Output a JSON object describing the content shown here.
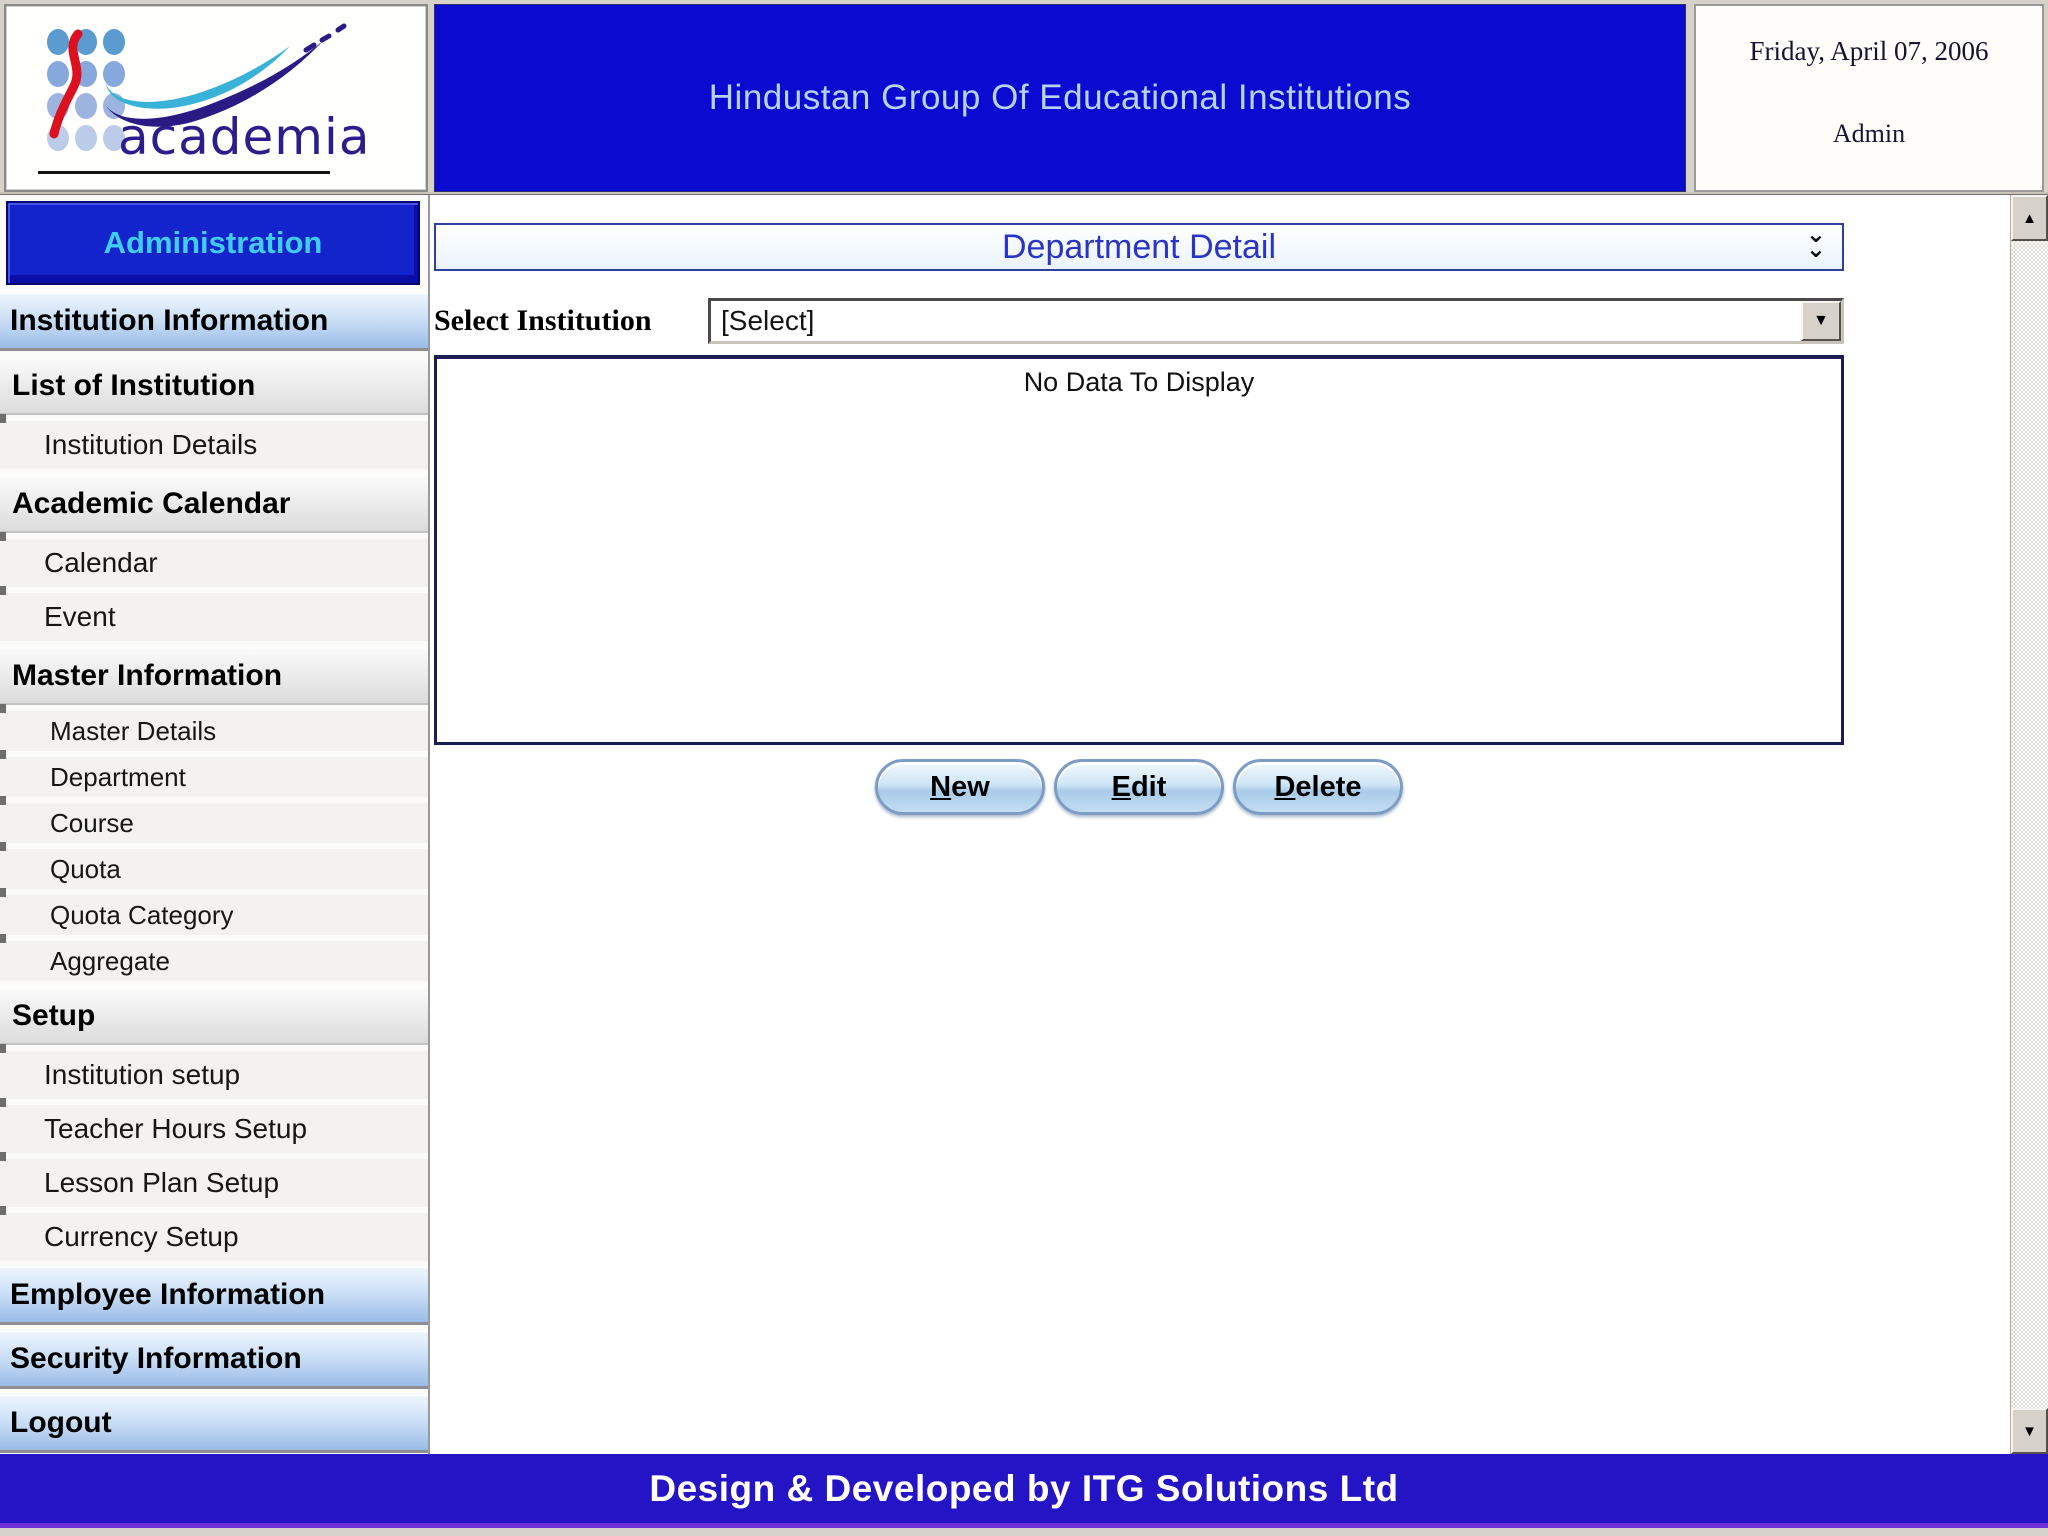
{
  "header": {
    "logo_brand": "academia",
    "title": "Hindustan Group Of Educational Institutions",
    "date": "Friday, April 07, 2006",
    "user": "Admin"
  },
  "sidebar": {
    "title": "Administration",
    "items": [
      {
        "label": "Institution Information",
        "kind": "module"
      },
      {
        "label": "List of Institution",
        "kind": "section"
      },
      {
        "label": "Institution Details",
        "kind": "link"
      },
      {
        "label": "Academic Calendar",
        "kind": "section"
      },
      {
        "label": "Calendar",
        "kind": "link"
      },
      {
        "label": "Event",
        "kind": "link"
      },
      {
        "label": "Master Information",
        "kind": "section"
      },
      {
        "label": "Master Details",
        "kind": "link"
      },
      {
        "label": "Department",
        "kind": "link"
      },
      {
        "label": "Course",
        "kind": "link"
      },
      {
        "label": "Quota",
        "kind": "link"
      },
      {
        "label": "Quota Category",
        "kind": "link"
      },
      {
        "label": "Aggregate",
        "kind": "link"
      },
      {
        "label": "Setup",
        "kind": "section"
      },
      {
        "label": "Institution setup",
        "kind": "link"
      },
      {
        "label": "Teacher Hours Setup",
        "kind": "link"
      },
      {
        "label": "Lesson Plan Setup",
        "kind": "link"
      },
      {
        "label": "Currency Setup",
        "kind": "link"
      },
      {
        "label": "Employee Information",
        "kind": "module"
      },
      {
        "label": "Security Information",
        "kind": "module"
      },
      {
        "label": "Logout",
        "kind": "module"
      }
    ]
  },
  "main": {
    "panel_title": "Department Detail",
    "select_label": "Select Institution",
    "select_value": "[Select]",
    "empty_message": "No Data To Display",
    "buttons": {
      "new": "New",
      "edit": "Edit",
      "delete": "Delete"
    }
  },
  "footer": {
    "text": "Design & Developed by ITG Solutions Ltd"
  },
  "icons": {
    "chevron_down": "⌄",
    "dropdown_arrow": "▼",
    "scroll_up": "▲",
    "scroll_down": "▼"
  },
  "colors": {
    "header_blue": "#0a0ad0",
    "footer_blue": "#2514c6",
    "admin_box_blue": "#1424cc",
    "admin_text_cyan": "#40cdf2",
    "panel_title_blue": "#2a35c8",
    "title_text_blue": "#b8d2f4"
  }
}
